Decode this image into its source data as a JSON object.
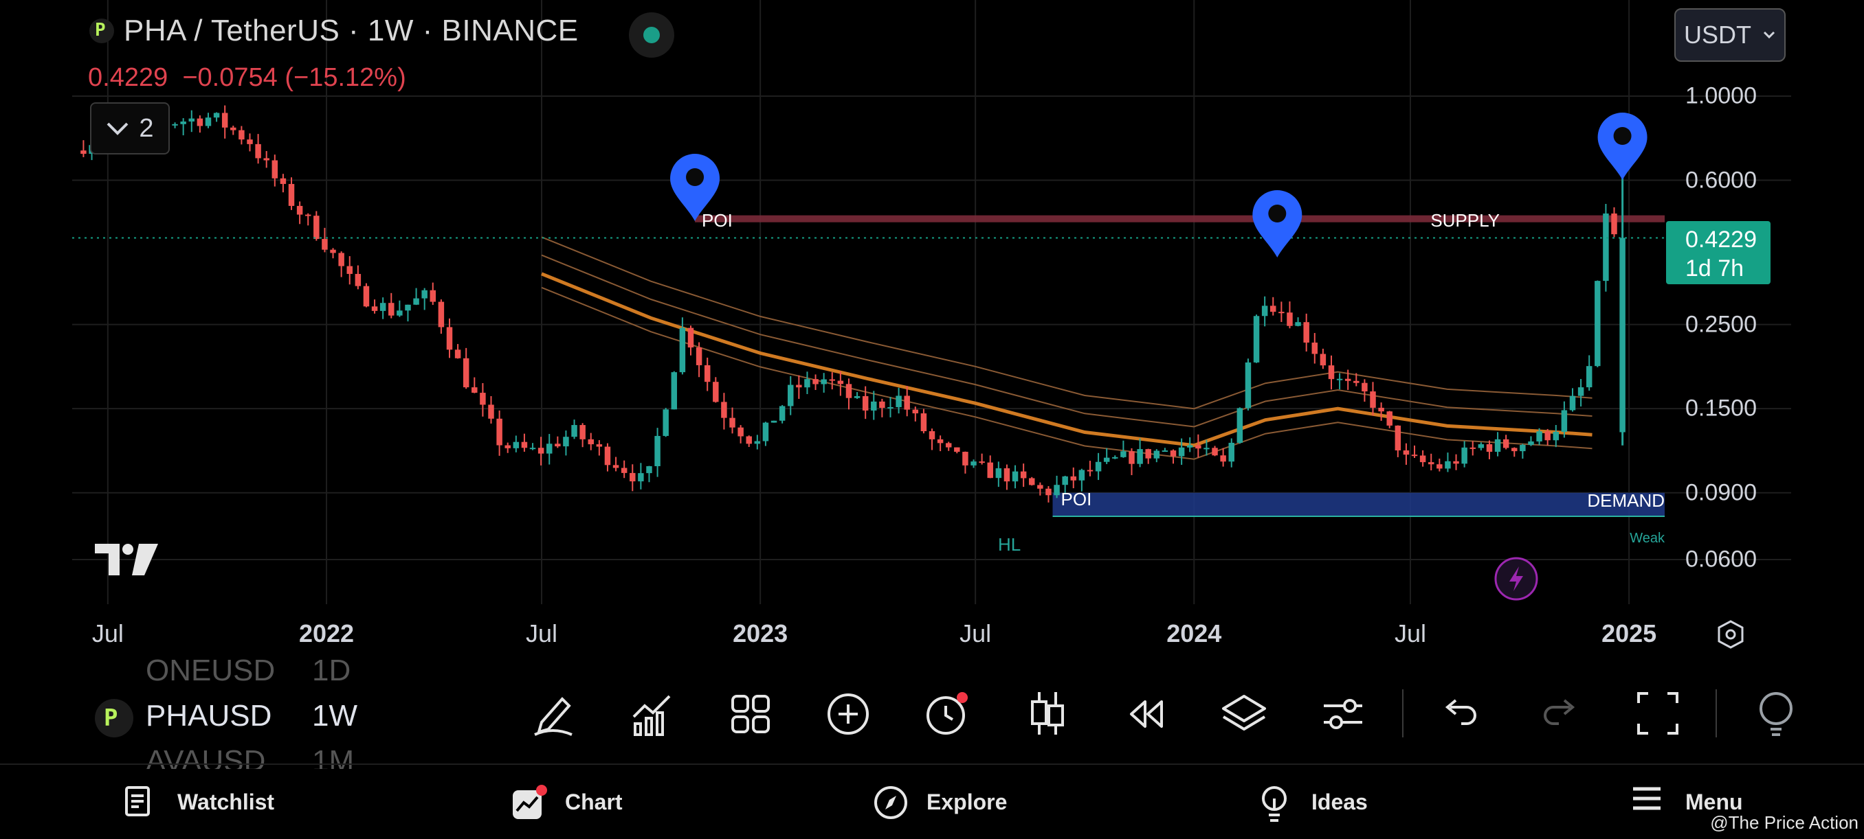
{
  "header": {
    "title": "PHA / TetherUS · 1W · BINANCE",
    "logo_letter": "P",
    "last_price": "0.4229",
    "change": "−0.0754",
    "change_pct": "(−15.12%)",
    "indicator_count": "2",
    "currency": "USDT"
  },
  "price_label": {
    "price": "0.4229",
    "countdown": "1d 7h"
  },
  "chart_data": {
    "type": "candlestick",
    "symbol": "PHA / TetherUS",
    "timeframe": "1W",
    "exchange": "BINANCE",
    "y_scale": "log",
    "y_ticks": [
      "1.0000",
      "0.6000",
      "0.2500",
      "0.1500",
      "0.0900",
      "0.0600"
    ],
    "x_ticks": [
      {
        "label": "Jul",
        "bold": false
      },
      {
        "label": "2022",
        "bold": true
      },
      {
        "label": "Jul",
        "bold": false
      },
      {
        "label": "2023",
        "bold": true
      },
      {
        "label": "Jul",
        "bold": false
      },
      {
        "label": "2024",
        "bold": true
      },
      {
        "label": "Jul",
        "bold": false
      },
      {
        "label": "2025",
        "bold": true
      }
    ],
    "last_price": 0.4229,
    "supply_zone": {
      "label": "SUPPLY",
      "low": 0.465,
      "high": 0.485
    },
    "demand_zone": {
      "label": "DEMAND",
      "low": 0.078,
      "high": 0.09
    },
    "annotations": [
      {
        "text": "POI",
        "zone": "supply"
      },
      {
        "text": "POI",
        "zone": "demand"
      },
      {
        "text": "HL"
      },
      {
        "text": "Weak"
      }
    ],
    "colors": {
      "up": "#26a69a",
      "down": "#ef5350",
      "ma_main": "#d07a22",
      "ma_thin": "#8a5a34",
      "supply": "#7a2a38",
      "demand": "#1f3a8a",
      "marker": "#2962ff",
      "last_price": "#15a186"
    },
    "price_path": [
      [
        "2021-06",
        0.7
      ],
      [
        "2021-07",
        0.8
      ],
      [
        "2021-09",
        0.86
      ],
      [
        "2021-10",
        0.88
      ],
      [
        "2021-11",
        0.76
      ],
      [
        "2021-12",
        0.55
      ],
      [
        "2022-01",
        0.42
      ],
      [
        "2022-02",
        0.3
      ],
      [
        "2022-03",
        0.27
      ],
      [
        "2022-04",
        0.3
      ],
      [
        "2022-05",
        0.18
      ],
      [
        "2022-06",
        0.12
      ],
      [
        "2022-07",
        0.115
      ],
      [
        "2022-08",
        0.13
      ],
      [
        "2022-09",
        0.11
      ],
      [
        "2022-10",
        0.095
      ],
      [
        "2022-11",
        0.25
      ],
      [
        "2022-12",
        0.15
      ],
      [
        "2023-01",
        0.12
      ],
      [
        "2023-02",
        0.17
      ],
      [
        "2023-03",
        0.18
      ],
      [
        "2023-04",
        0.15
      ],
      [
        "2023-05",
        0.16
      ],
      [
        "2023-06",
        0.12
      ],
      [
        "2023-07",
        0.105
      ],
      [
        "2023-08",
        0.1
      ],
      [
        "2023-09",
        0.09
      ],
      [
        "2023-10",
        0.1
      ],
      [
        "2023-11",
        0.11
      ],
      [
        "2023-12",
        0.115
      ],
      [
        "2024-01",
        0.12
      ],
      [
        "2024-02",
        0.105
      ],
      [
        "2024-03",
        0.3
      ],
      [
        "2024-04",
        0.25
      ],
      [
        "2024-05",
        0.18
      ],
      [
        "2024-06",
        0.16
      ],
      [
        "2024-07",
        0.11
      ],
      [
        "2024-08",
        0.105
      ],
      [
        "2024-09",
        0.12
      ],
      [
        "2024-10",
        0.12
      ],
      [
        "2024-11",
        0.13
      ],
      [
        "2024-12",
        0.18
      ],
      [
        "2024-12-16",
        0.5
      ],
      [
        "2024-12-23",
        0.4229
      ]
    ],
    "ma_path": [
      [
        "2022-07",
        0.34
      ],
      [
        "2022-10",
        0.26
      ],
      [
        "2023-01",
        0.21
      ],
      [
        "2023-04",
        0.18
      ],
      [
        "2023-07",
        0.155
      ],
      [
        "2023-10",
        0.13
      ],
      [
        "2024-01",
        0.12
      ],
      [
        "2024-03",
        0.14
      ],
      [
        "2024-05",
        0.15
      ],
      [
        "2024-08",
        0.135
      ],
      [
        "2024-11",
        0.13
      ],
      [
        "2024-12",
        0.128
      ]
    ]
  },
  "symbols": [
    {
      "name": "ONEUSD",
      "tf": "1D"
    },
    {
      "name": "PHAUSD",
      "tf": "1W"
    },
    {
      "name": "AVAUSD",
      "tf": "1M"
    }
  ],
  "toolbar_icons": [
    "pen-icon",
    "indicators-icon",
    "layout-icon",
    "add-icon",
    "alert-icon",
    "candles-icon",
    "replay-icon",
    "layers-icon",
    "settings-icon",
    "undo-icon",
    "redo-icon",
    "fullscreen-icon",
    "ideas-icon"
  ],
  "nav": {
    "watchlist": "Watchlist",
    "chart": "Chart",
    "explore": "Explore",
    "ideas": "Ideas",
    "menu": "Menu"
  },
  "credit": "@The Price Action"
}
